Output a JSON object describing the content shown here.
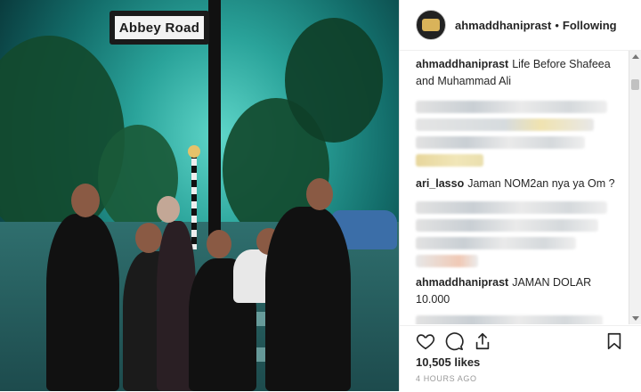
{
  "photo": {
    "street_sign": "Abbey Road"
  },
  "header": {
    "username": "ahmaddhaniprast",
    "separator": "•",
    "follow_status": "Following"
  },
  "comments": [
    {
      "user": "ahmaddhaniprast",
      "text": "Life Before Shafeea and Muhammad Ali"
    },
    {
      "user": "ari_lasso",
      "text": "Jaman NOM2an nya ya Om ?"
    },
    {
      "user": "ahmaddhaniprast",
      "text": "JAMAN DOLAR 10.000"
    }
  ],
  "actions": {
    "likes": "10,505 likes",
    "timestamp": "4 HOURS AGO",
    "icons": [
      "heart-icon",
      "comment-icon",
      "share-icon",
      "bookmark-icon"
    ]
  },
  "colors": {
    "text": "#262626",
    "muted": "#999999",
    "photo_tint": "#2aa39a"
  }
}
